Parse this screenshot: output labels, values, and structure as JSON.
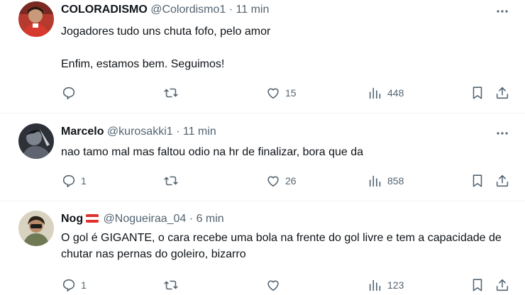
{
  "tweets": [
    {
      "name": "COLORADISMO",
      "handle": "@Colordismo1",
      "separator": "·",
      "time": "11 min",
      "text": "Jogadores tudo uns chuta fofo, pelo amor\n\nEnfim, estamos bem. Seguimos!",
      "replies": "",
      "retweets": "",
      "likes": "15",
      "views": "448",
      "avatar_colors": {
        "bg": "#c7372b",
        "skin": "#c99a7a",
        "hair": "#2a1a12"
      }
    },
    {
      "name": "Marcelo",
      "handle": "@kurosakki1",
      "separator": "·",
      "time": "11 min",
      "text": "nao tamo mal mas faltou odio na hr de finalizar, bora que da",
      "replies": "1",
      "retweets": "",
      "likes": "26",
      "views": "858",
      "avatar_colors": {
        "bg": "#3b4048",
        "skin": "#8a9099",
        "hair": "#1d2026"
      }
    },
    {
      "name": "Nog",
      "handle": "@Nogueiraa_04",
      "separator": "·",
      "time": "6 min",
      "text": "O gol é GIGANTE, o cara recebe uma bola na frente do gol livre e tem a capacidade de chutar nas pernas do goleiro, bizarro",
      "replies": "1",
      "retweets": "",
      "likes": "",
      "views": "123",
      "avatar_colors": {
        "bg": "#d9d3c2",
        "skin": "#b98b6a",
        "hair": "#2b2119"
      }
    }
  ],
  "icons": {
    "more": "more-icon",
    "reply": "reply-icon",
    "retweet": "retweet-icon",
    "like": "like-icon",
    "views": "views-icon",
    "bookmark": "bookmark-icon",
    "share": "share-icon"
  }
}
